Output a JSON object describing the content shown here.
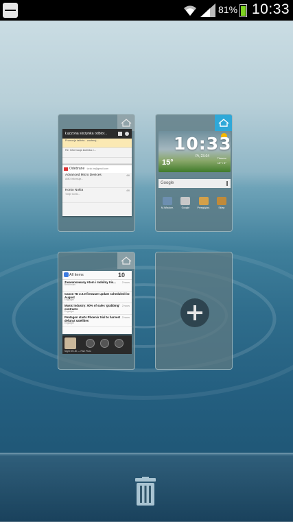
{
  "status_bar": {
    "battery_text": "81%",
    "battery_level": 0.81,
    "time": "10:33",
    "icons": [
      "back-icon",
      "wifi-icon",
      "signal-icon",
      "battery-icon"
    ]
  },
  "pages": [
    {
      "home": false,
      "widget": "email",
      "email": {
        "title": "Łączona skrzynka odbior...",
        "rows": [
          "Promocja tabletu - zaoferuj...",
          "Re: Informacja kabinka z..."
        ],
        "account_label": "Odebrane",
        "account_address": "ta.sk.hs@gmail.com",
        "items": [
          {
            "sender": "Advanced Micro Devices",
            "date": "4/6",
            "preview": "AMD Informuje..."
          },
          {
            "sender": "Konto Nokia",
            "date": "4/6",
            "preview": "Twoje konto..."
          }
        ]
      }
    },
    {
      "home": true,
      "widget": "clock",
      "clock": {
        "time": "10:33",
        "date": "Pt, 23.04",
        "temperature": "15°",
        "city": "Tłuszcz",
        "city_detail": "15° / 5°",
        "search_label": "Google",
        "apps": [
          {
            "label": "M.Wiadom.",
            "color": "#6d8fb0"
          },
          {
            "label": "Google",
            "color": "#c8c8c8"
          },
          {
            "label": "Przeglądar.",
            "color": "#d4a049"
          },
          {
            "label": "Sklep",
            "color": "#c08a3a"
          }
        ]
      }
    },
    {
      "home": false,
      "widget": "news",
      "news": {
        "header": "All items",
        "count": "10",
        "items": [
          {
            "title": "Zaawansowany Atom i mobilny Iris...",
            "time": "2 hours",
            "source": "Benchmark"
          },
          {
            "title": "Canon 7D 2.0.0 firmware update scheduled for August",
            "time": "2 hours",
            "source": "Engadget"
          },
          {
            "title": "Music industry: 90% of sales 'grabbing' contracts",
            "time": "2 hours",
            "source": "Engadget"
          },
          {
            "title": "Pentagon starts Phoenix trial to harvest defunct satellites",
            "time": "2 hours",
            "source": "Engadget"
          }
        ],
        "player_caption": "Night Of Life — Pam Pluto"
      }
    },
    {
      "widget": "add",
      "add_icon": "plus-icon"
    }
  ],
  "trash": {
    "icon": "trash-icon"
  },
  "colors": {
    "home_active": "#2fa8d8",
    "battery_fill": "#7ed321"
  }
}
